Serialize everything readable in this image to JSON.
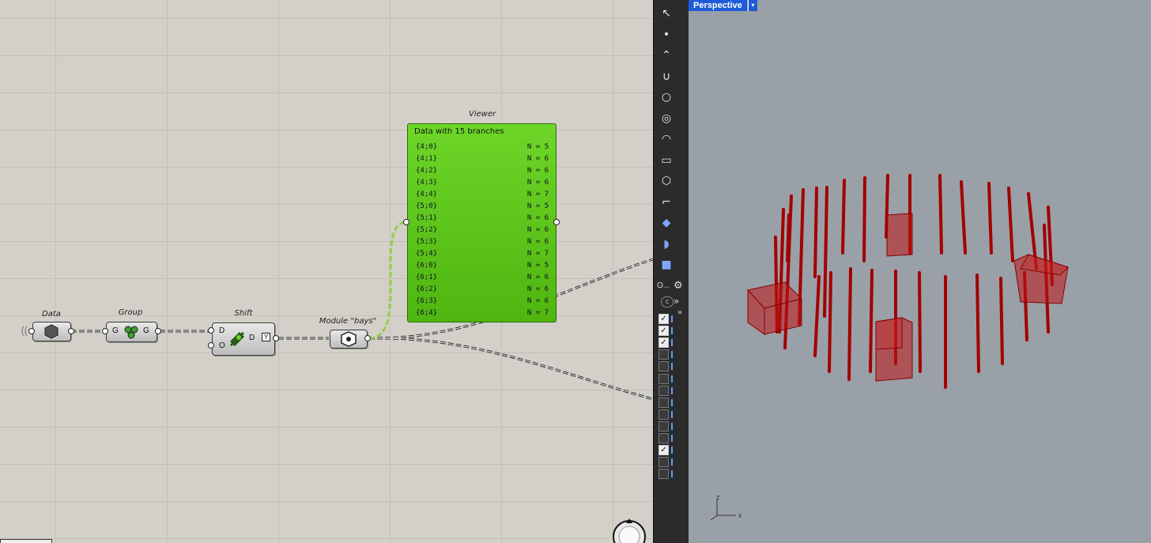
{
  "canvas": {
    "components": {
      "data": {
        "label": "Data"
      },
      "group": {
        "label": "Group",
        "in": "G",
        "out": "G"
      },
      "shift": {
        "label": "Shift",
        "in_d": "D",
        "in_o": "O",
        "out_d": "D",
        "out_y": "Y"
      },
      "module": {
        "label": "Module \"bays\""
      },
      "viewer": {
        "label": "Viewer",
        "header": "Data with 15 branches",
        "rows": [
          {
            "path": "{4;0}",
            "count": "N = 5"
          },
          {
            "path": "{4;1}",
            "count": "N = 6"
          },
          {
            "path": "{4;2}",
            "count": "N = 6"
          },
          {
            "path": "{4;3}",
            "count": "N = 6"
          },
          {
            "path": "{4;4}",
            "count": "N = 7"
          },
          {
            "path": "{5;0}",
            "count": "N = 5"
          },
          {
            "path": "{5;1}",
            "count": "N = 6"
          },
          {
            "path": "{5;2}",
            "count": "N = 6"
          },
          {
            "path": "{5;3}",
            "count": "N = 6"
          },
          {
            "path": "{5;4}",
            "count": "N = 7"
          },
          {
            "path": "{6;0}",
            "count": "N = 5"
          },
          {
            "path": "{6;1}",
            "count": "N = 6"
          },
          {
            "path": "{6;2}",
            "count": "N = 6"
          },
          {
            "path": "{6;3}",
            "count": "N = 6"
          },
          {
            "path": "{6;4}",
            "count": "N = 7"
          }
        ]
      }
    }
  },
  "toolbar": {
    "tools": [
      "select-arrow-icon",
      "point-icon",
      "polyline-icon",
      "curve-icon",
      "circle-icon",
      "ellipse-icon",
      "arc-icon",
      "rectangle-icon",
      "polygon-icon",
      "fillet-icon",
      "surface-icon",
      "extrude-icon",
      "box-icon"
    ],
    "search_label": "O...",
    "expand_label": "»",
    "layers": [
      {
        "checked": true
      },
      {
        "checked": true
      },
      {
        "checked": true
      },
      {
        "checked": false
      },
      {
        "checked": false
      },
      {
        "checked": false
      },
      {
        "checked": false
      },
      {
        "checked": false
      },
      {
        "checked": false
      },
      {
        "checked": false
      },
      {
        "checked": false
      },
      {
        "checked": true
      },
      {
        "checked": false
      },
      {
        "checked": false
      }
    ]
  },
  "viewport": {
    "title": "Perspective",
    "dropdown": "▾",
    "axis": {
      "z": "z",
      "x": "x"
    },
    "colors": {
      "background": "#9aa0a8",
      "geometry": "#a30000",
      "accent": "#1e5bd6"
    }
  }
}
